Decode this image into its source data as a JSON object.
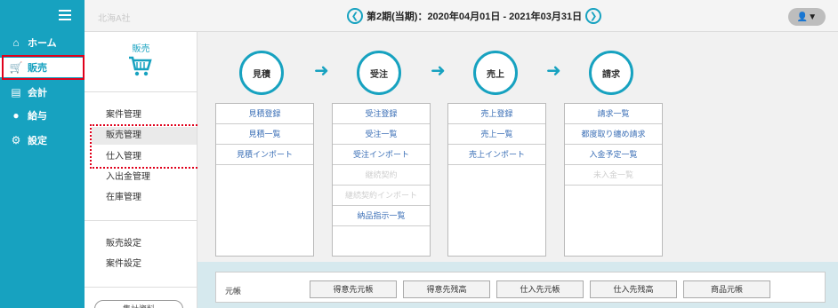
{
  "topbar": {
    "company": "北海A社",
    "period": "第2期(当期)：2020年04月01日 - 2021年03月31日",
    "prev_glyph": "❮",
    "next_glyph": "❯",
    "user_icon": "user-icon"
  },
  "leftnav": {
    "items": [
      {
        "label": "ホーム",
        "icon": "home-icon"
      },
      {
        "label": "販売",
        "icon": "cart-icon"
      },
      {
        "label": "会計",
        "icon": "calculator-icon"
      },
      {
        "label": "給与",
        "icon": "moneybag-icon"
      },
      {
        "label": "設定",
        "icon": "gear-icon"
      }
    ]
  },
  "submenu": {
    "title": "販売",
    "items": [
      "案件管理",
      "販売管理",
      "仕入管理",
      "入出金管理",
      "在庫管理",
      "販売設定",
      "案件設定"
    ],
    "bottom_button": "集計資料"
  },
  "stages": [
    "見積",
    "受注",
    "売上",
    "請求"
  ],
  "columns": [
    {
      "links": [
        {
          "text": "見積登録",
          "disabled": false
        },
        {
          "text": "見積一覧",
          "disabled": false
        },
        {
          "text": "見積インポート",
          "disabled": false
        }
      ]
    },
    {
      "links": [
        {
          "text": "受注登録",
          "disabled": false
        },
        {
          "text": "受注一覧",
          "disabled": false
        },
        {
          "text": "受注インポート",
          "disabled": false
        },
        {
          "text": "継続契約",
          "disabled": true
        },
        {
          "text": "継続契約インポート",
          "disabled": true
        },
        {
          "text": "納品指示一覧",
          "disabled": false
        }
      ]
    },
    {
      "links": [
        {
          "text": "売上登録",
          "disabled": false
        },
        {
          "text": "売上一覧",
          "disabled": false
        },
        {
          "text": "売上インポート",
          "disabled": false
        }
      ]
    },
    {
      "links": [
        {
          "text": "請求一覧",
          "disabled": false
        },
        {
          "text": "都度取り纏め請求",
          "disabled": false
        },
        {
          "text": "入金予定一覧",
          "disabled": false
        },
        {
          "text": "未入金一覧",
          "disabled": true
        }
      ]
    }
  ],
  "ledger": {
    "label": "元帳",
    "buttons": [
      "得意先元帳",
      "得意先残高",
      "仕入先元帳",
      "仕入先残高",
      "商品元帳"
    ]
  },
  "colors": {
    "accent": "#17a2c0",
    "highlight": "#e0001b",
    "link": "#3b6fb6"
  }
}
